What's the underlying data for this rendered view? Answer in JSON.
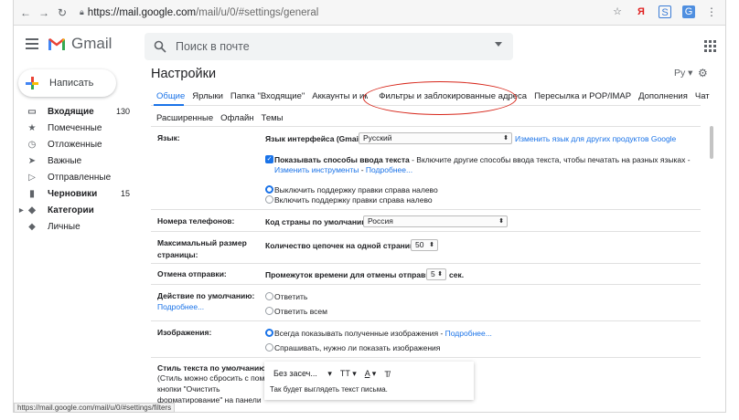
{
  "browser": {
    "url_main": "https://mail.google.com",
    "url_path": "/mail/u/0/#settings/general"
  },
  "header": {
    "app_name": "Gmail",
    "search_placeholder": "Поиск в почте"
  },
  "compose_label": "Написать",
  "sidebar": {
    "items": [
      {
        "label": "Входящие",
        "count": "130"
      },
      {
        "label": "Помеченные",
        "count": ""
      },
      {
        "label": "Отложенные",
        "count": ""
      },
      {
        "label": "Важные",
        "count": ""
      },
      {
        "label": "Отправленные",
        "count": ""
      },
      {
        "label": "Черновики",
        "count": "15"
      },
      {
        "label": "Категории",
        "count": ""
      },
      {
        "label": "Личные",
        "count": ""
      }
    ]
  },
  "settings": {
    "title": "Настройки",
    "language_short": "Ру",
    "tabs": [
      "Общие",
      "Ярлыки",
      "Папка \"Входящие\"",
      "Аккаунты и импорт",
      "Фильтры и заблокированные адреса",
      "Пересылка и POP/IMAP",
      "Дополнения",
      "Чат"
    ],
    "tabs2": [
      "Расширенные",
      "Офлайн",
      "Темы"
    ],
    "language": {
      "label": "Язык:",
      "interface_label": "Язык интерфейса (Gmail):",
      "interface_value": "Русский",
      "change_other": "Изменить язык для других продуктов Google",
      "input_tools_bold": "Показывать способы ввода текста",
      "input_tools_rest": " - Включите другие способы ввода текста, чтобы печатать на разных языках -",
      "change_tools": "Изменить инструменты",
      "more": "Подробнее...",
      "rtl_off": "Выключить поддержку правки справа налево",
      "rtl_on": "Включить поддержку правки справа налево"
    },
    "phone": {
      "label": "Номера телефонов:",
      "country_label": "Код страны по умолчанию:",
      "country_value": "Россия"
    },
    "page_size": {
      "label_line1": "Максимальный размер",
      "label_line2": "страницы:",
      "text": "Количество цепочек на одной странице:",
      "value": "50"
    },
    "undo": {
      "label": "Отмена отправки:",
      "text": "Промежуток времени для отмены отправки:",
      "value": "5",
      "unit": "сек."
    },
    "default_action": {
      "label": "Действие по умолчанию:",
      "more": "Подробнее...",
      "opt1": "Ответить",
      "opt2": "Ответить всем"
    },
    "images": {
      "label": "Изображения:",
      "opt1": "Всегда показывать полученные изображения",
      "opt1_link": "Подробнее...",
      "opt2": "Спрашивать, нужно ли показать изображения"
    },
    "text_style": {
      "label": "Стиль текста по умолчанию:",
      "hint1": "(Стиль можно сбросить с помощью",
      "hint2": "кнопки \"Очистить",
      "hint3": "форматирование\" на панели",
      "font": "Без засеч...",
      "sample": "Так будет выглядеть текст письма."
    }
  },
  "status_url": "https://mail.google.com/mail/u/0/#settings/filters"
}
